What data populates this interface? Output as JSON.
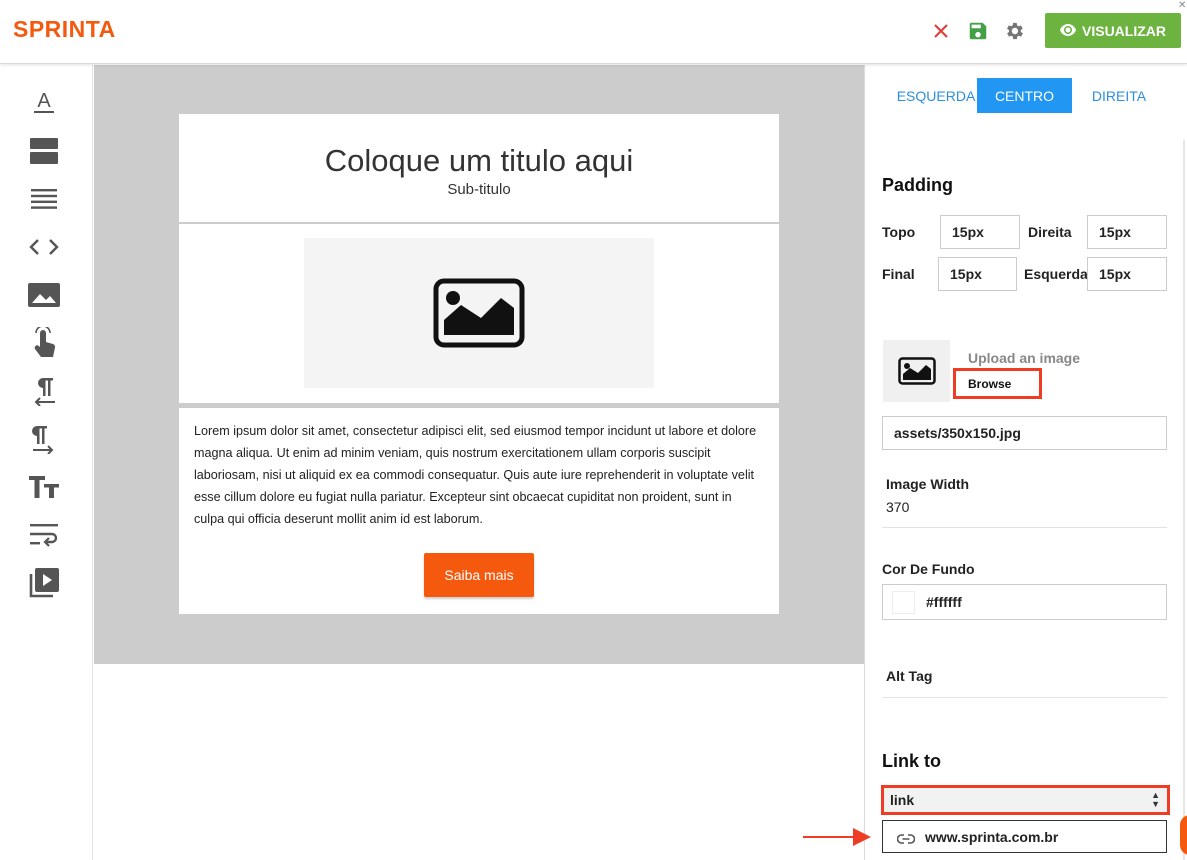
{
  "app": {
    "logo": "SPRINTA"
  },
  "toolbar": {
    "preview_label": "VISUALIZAR"
  },
  "email": {
    "title": "Coloque um titulo aqui",
    "subtitle": "Sub-titulo",
    "body": "Lorem ipsum dolor sit amet, consectetur adipisci elit, sed eiusmod tempor incidunt ut labore et dolore magna aliqua. Ut enim ad minim veniam, quis nostrum exercitationem ullam corporis suscipit laboriosam, nisi ut aliquid ex ea commodi consequatur. Quis aute iure reprehenderit in voluptate velit esse cillum dolore eu fugiat nulla pariatur. Excepteur sint obcaecat cupiditat non proident, sunt in culpa qui officia deserunt mollit anim id est laborum.",
    "button_label": "Saiba mais"
  },
  "panel": {
    "align_tabs": [
      "ESQUERDA",
      "CENTRO",
      "DIREITA"
    ],
    "padding_heading": "Padding",
    "padding": {
      "top_label": "Topo",
      "top_value": "15px",
      "right_label": "Direita",
      "right_value": "15px",
      "bottom_label": "Final",
      "bottom_value": "15px",
      "left_label": "Esquerda",
      "left_value": "15px"
    },
    "upload_title": "Upload an image",
    "browse_label": "Browse",
    "image_path": "assets/350x150.jpg",
    "image_width_label": "Image Width",
    "image_width_value": "370",
    "bg_color_label": "Cor De Fundo",
    "bg_color_value": "#ffffff",
    "alt_tag_label": "Alt Tag",
    "link_heading": "Link to",
    "link_type": "link",
    "link_url": "www.sprinta.com.br"
  },
  "colors": {
    "brand": "#f4590e",
    "preview_button": "#6db33f",
    "active_tab": "#2196f3",
    "highlight": "#ee3d24"
  }
}
